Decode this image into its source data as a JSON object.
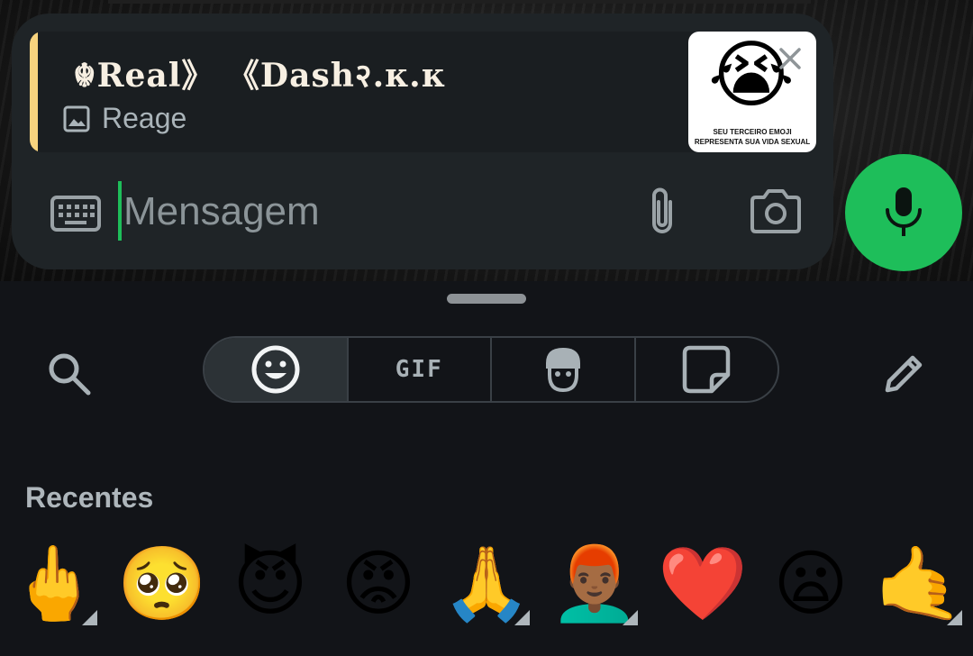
{
  "reply": {
    "author": "☬Real》 《Dash२.ᴋ.ᴋ",
    "icon": "image-icon",
    "type_label": "Reage",
    "thumbnail": {
      "emoji": "😭",
      "caption_line1": "SEU TERCEIRO EMOJI",
      "caption_line2": "REPRESENTA SUA VIDA SEXUAL"
    },
    "bar_color": "#f7d37e"
  },
  "composer": {
    "placeholder": "Mensagem",
    "value": "",
    "icons": [
      "keyboard-icon",
      "paperclip-icon",
      "camera-icon",
      "close-icon"
    ]
  },
  "mic": {
    "icon": "microphone-icon",
    "color": "#1ebe5a"
  },
  "picker": {
    "tabs": [
      {
        "name": "emoji",
        "icon": "smiley-icon",
        "active": true
      },
      {
        "name": "gif",
        "label": "GIF",
        "active": false
      },
      {
        "name": "avatar",
        "icon": "avatar-icon",
        "active": false
      },
      {
        "name": "stickers",
        "icon": "sticker-icon",
        "active": false
      }
    ],
    "search_icon": "search-icon",
    "edit_icon": "pencil-icon",
    "section_title": "Recentes",
    "recent_emojis": [
      "🖕",
      "🥺",
      "😈",
      "😡",
      "🙏",
      "👨🏾‍🦰",
      "❤️",
      "😦",
      "🤙"
    ],
    "variant_flags": [
      true,
      false,
      false,
      false,
      true,
      true,
      false,
      false,
      true
    ]
  }
}
